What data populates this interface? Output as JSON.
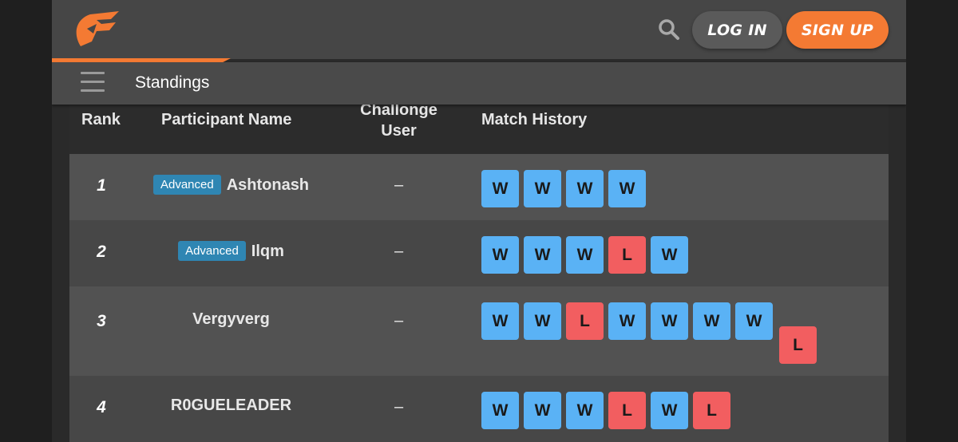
{
  "header": {
    "logo_icon": "brand-logo-icon",
    "search_icon": "search-icon",
    "login_label": "LOG IN",
    "signup_label": "SIGN UP"
  },
  "subbar": {
    "menu_icon": "hamburger-menu-icon",
    "title": "Standings"
  },
  "colors": {
    "accent": "#f47a33",
    "win": "#5ab2f5",
    "loss": "#f25e60",
    "badge": "#2f86b3"
  },
  "table": {
    "columns": {
      "rank": "Rank",
      "participant": "Participant Name",
      "challenge_line1": "Challonge",
      "challenge_line2": "User",
      "history": "Match History"
    },
    "rows": [
      {
        "rank": "1",
        "badge": "Advanced",
        "name": "Ashtonash",
        "challenge_user": "–",
        "history": [
          "W",
          "W",
          "W",
          "W"
        ]
      },
      {
        "rank": "2",
        "badge": "Advanced",
        "name": "Ilqm",
        "challenge_user": "–",
        "history": [
          "W",
          "W",
          "W",
          "L",
          "W"
        ]
      },
      {
        "rank": "3",
        "badge": "",
        "name": "Vergyverg",
        "challenge_user": "–",
        "history": [
          "W",
          "W",
          "L",
          "W",
          "W",
          "W",
          "W",
          "L"
        ]
      },
      {
        "rank": "4",
        "badge": "",
        "name": "R0GUELEADER",
        "challenge_user": "–",
        "history": [
          "W",
          "W",
          "W",
          "L",
          "W",
          "L"
        ]
      }
    ]
  }
}
